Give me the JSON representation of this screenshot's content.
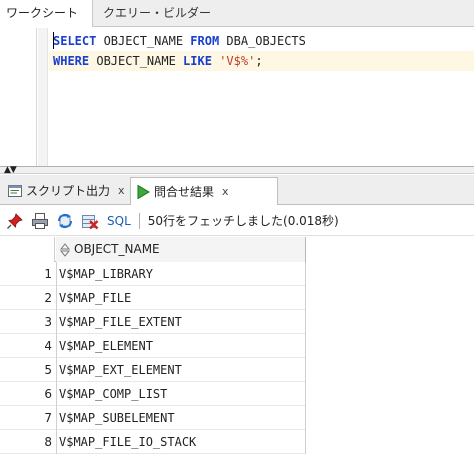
{
  "worksheet_tabs": [
    {
      "label": "ワークシート"
    },
    {
      "label": "クエリー・ビルダー"
    }
  ],
  "editor": {
    "line1": {
      "kw1": "SELECT",
      "t1": " OBJECT_NAME ",
      "kw2": "FROM",
      "t2": " DBA_OBJECTS"
    },
    "line2": {
      "kw1": "WHERE",
      "t1": " OBJECT_NAME ",
      "kw2": "LIKE",
      "t2": " ",
      "str": "'V$%'",
      "t3": ";"
    }
  },
  "splitter": {
    "arrows": "▲▼"
  },
  "result_tabs": [
    {
      "label": "スクリプト出力",
      "close": "x",
      "icon": "script-output-icon"
    },
    {
      "label": "問合せ結果",
      "close": "x",
      "icon": "run-query-icon"
    }
  ],
  "toolbar": {
    "sql_label": "SQL",
    "status": "50行をフェッチしました(0.018秒)",
    "icons": [
      "pin-icon",
      "print-icon",
      "refresh-icon",
      "clear-icon"
    ]
  },
  "grid": {
    "column_header": "OBJECT_NAME",
    "rows": [
      {
        "num": "1",
        "value": "V$MAP_LIBRARY"
      },
      {
        "num": "2",
        "value": "V$MAP_FILE"
      },
      {
        "num": "3",
        "value": "V$MAP_FILE_EXTENT"
      },
      {
        "num": "4",
        "value": "V$MAP_ELEMENT"
      },
      {
        "num": "5",
        "value": "V$MAP_EXT_ELEMENT"
      },
      {
        "num": "6",
        "value": "V$MAP_COMP_LIST"
      },
      {
        "num": "7",
        "value": "V$MAP_SUBELEMENT"
      },
      {
        "num": "8",
        "value": "V$MAP_FILE_IO_STACK"
      }
    ]
  },
  "colors": {
    "keyword": "#1a3fd1",
    "string": "#c0392b",
    "accent": "#1a5fb4"
  }
}
